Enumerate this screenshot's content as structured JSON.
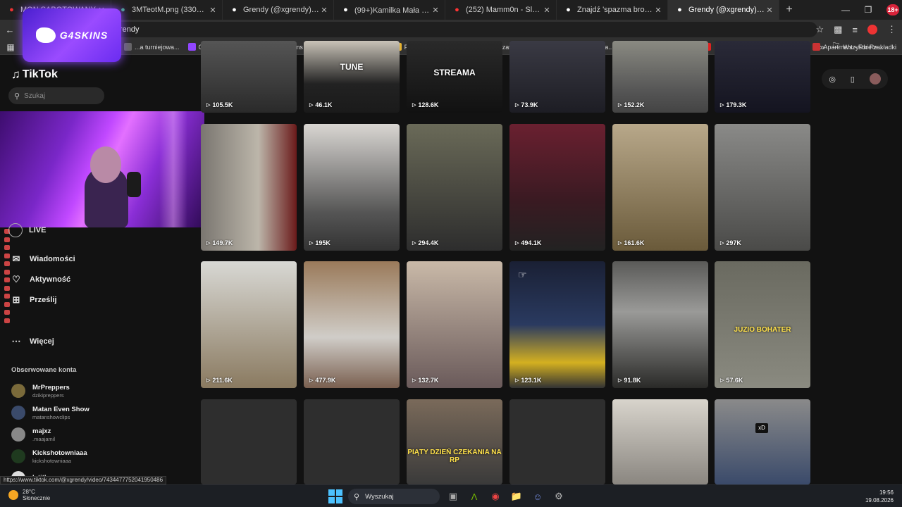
{
  "browser": {
    "tabs": [
      {
        "label": "MON SABOTOWANY",
        "icon": "record-icon",
        "color": "#e33"
      },
      {
        "label": "3MTeotM.png (330×58)",
        "icon": "image-icon",
        "color": "#4a8"
      },
      {
        "label": "Grendy (@xgrendy) | TikTok",
        "icon": "tiktok-icon",
        "color": "#fff"
      },
      {
        "label": "(99+)Kamilka Mała Iskierka 🌟",
        "icon": "tiktok-icon",
        "color": "#fff"
      },
      {
        "label": "(252) Mamm0n - Sleepy Voice",
        "icon": "youtube-icon",
        "color": "#f33"
      },
      {
        "label": "Znajdź 'spazma brokies' na Tik",
        "icon": "tiktok-icon",
        "color": "#fff"
      },
      {
        "label": "Grendy (@xgrendy) | TikTok",
        "icon": "tiktok-icon",
        "color": "#fff",
        "active": true
      }
    ],
    "new_tab": "+",
    "url": "rendy",
    "profile_badge": "18+",
    "bookmarks": [
      {
        "label": "...a turniejowa...",
        "color": "#666"
      },
      {
        "label": "Grendy – czat - Twit...",
        "color": "#9146ff"
      },
      {
        "label": "G4Skins | Skrzynki -...",
        "color": "#7b3fe4"
      },
      {
        "label": "YouTube",
        "color": "#f00"
      },
      {
        "label": "Prodigy Roleplay",
        "color": "#e8b430"
      },
      {
        "label": "Grendy – czat - Twit...",
        "color": "#9146ff"
      },
      {
        "label": "grendy Stream - Wa...",
        "color": "#53fc18"
      },
      {
        "label": "Kick",
        "color": "#53fc18"
      },
      {
        "label": "Messenger",
        "color": "#1877f2"
      },
      {
        "label": "DZ",
        "color": "#d22"
      },
      {
        "label": "Watch XD | Streama...",
        "color": "#2b7bd6"
      },
      {
        "label": "Apartment - For Re...",
        "color": "#c33"
      }
    ],
    "all_bookmarks": "Wszystkie zakładki",
    "status_url": "https://www.tiktok.com/@xgrendy/video/7434477752041950486"
  },
  "overlay": {
    "logo_text": "G4SKINS"
  },
  "tiktok": {
    "logo": "TikTok",
    "search_placeholder": "Szukaj",
    "nav": [
      {
        "label": "LIVE",
        "icon": "live-icon"
      },
      {
        "label": "Wiadomości",
        "icon": "message-icon"
      },
      {
        "label": "Aktywność",
        "icon": "activity-icon"
      },
      {
        "label": "Prześlij",
        "icon": "upload-icon"
      },
      {
        "label": "Więcej",
        "icon": "more-icon"
      }
    ],
    "followed_title": "Obserwowane konta",
    "followed": [
      {
        "name": "MrPreppers",
        "handle": "dzikipreppers",
        "color": "#7a6a3a"
      },
      {
        "name": "Matan Even Show",
        "handle": "matanshowclips",
        "color": "#3a4a6a"
      },
      {
        "name": "majxz",
        "handle": ".maajamil",
        "color": "#888"
      },
      {
        "name": "Kickshotowniaaa",
        "handle": "kickshotowniaaa",
        "color": "#1f3a1f"
      },
      {
        "name": "letith",
        "handle": "",
        "color": "#ddd"
      }
    ],
    "videos": [
      {
        "views": "105.5K",
        "bg": "linear-gradient(#555,#2a2a2a)"
      },
      {
        "views": "46.1K",
        "bg": "linear-gradient(#c9c3b8,#222 60%,#1a1a1a)",
        "text": "TUNE",
        "text_top": 30
      },
      {
        "views": "128.6K",
        "bg": "linear-gradient(#2a2a2a,#111)",
        "text": "STREAMA",
        "text_top": 38
      },
      {
        "views": "73.9K",
        "bg": "linear-gradient(#3a3a44,#1d1d24)"
      },
      {
        "views": "152.2K",
        "bg": "linear-gradient(#8a8a82,#555 70%,#444)"
      },
      {
        "views": "179.3K",
        "bg": "linear-gradient(#2a2a38,#141420)"
      },
      {
        "views": "149.7K",
        "bg": "linear-gradient(90deg,#7a7670,#bcb6aa 60%,#6a1a1a)"
      },
      {
        "views": "195K",
        "bg": "linear-gradient(#d9d6d2,#555 70%,#333)"
      },
      {
        "views": "294.4K",
        "bg": "linear-gradient(#6a6a58,#2d2d2d)"
      },
      {
        "views": "494.1K",
        "bg": "linear-gradient(#6a2030,#3a1a22 60%,#222)"
      },
      {
        "views": "161.6K",
        "bg": "linear-gradient(#b8a88a,#6a5a3a)"
      },
      {
        "views": "297K",
        "bg": "linear-gradient(#8a8a88,#4a4a48)"
      },
      {
        "views": "211.6K",
        "bg": "linear-gradient(#d8d8d4,#8a7a60)"
      },
      {
        "views": "477.9K",
        "bg": "linear-gradient(#9a7a5a,#d0cdc8 60%,#7a6050)"
      },
      {
        "views": "132.7K",
        "bg": "linear-gradient(#c9b9a8,#6a5a5a)"
      },
      {
        "views": "123.1K",
        "bg": "linear-gradient(#1a2034,#2a3a60 50%,#d4b020 80%,#333)"
      },
      {
        "views": "91.8K",
        "bg": "linear-gradient(#5a5a58,#9a9a98 40%,#2a2a28)"
      },
      {
        "views": "57.6K",
        "bg": "linear-gradient(#6a6a60,#8a8a80)",
        "text": "JUZIO BOHATER",
        "text_top": 92,
        "yellow": true
      },
      {
        "views": "",
        "bg": "#2e2e2e"
      },
      {
        "views": "",
        "bg": "#2e2e2e"
      },
      {
        "views": "",
        "bg": "linear-gradient(#7a6a5a,#3a3a3a)",
        "text": "PIĄTY DZIEŃ CZEKANIA NA RP",
        "text_top": 70,
        "yellow": true
      },
      {
        "views": "",
        "bg": "#2e2e2e"
      },
      {
        "views": "",
        "bg": "linear-gradient(#d8d4cc,#8a8680)"
      },
      {
        "views": "",
        "bg": "linear-gradient(#8a8a8a,#3a4a6a)",
        "xd": "xD"
      }
    ]
  },
  "taskbar": {
    "weather_temp": "28°C",
    "weather_desc": "Słonecznie",
    "search": "Wyszukaj",
    "time": "19:56",
    "date": "19.08.2026"
  }
}
